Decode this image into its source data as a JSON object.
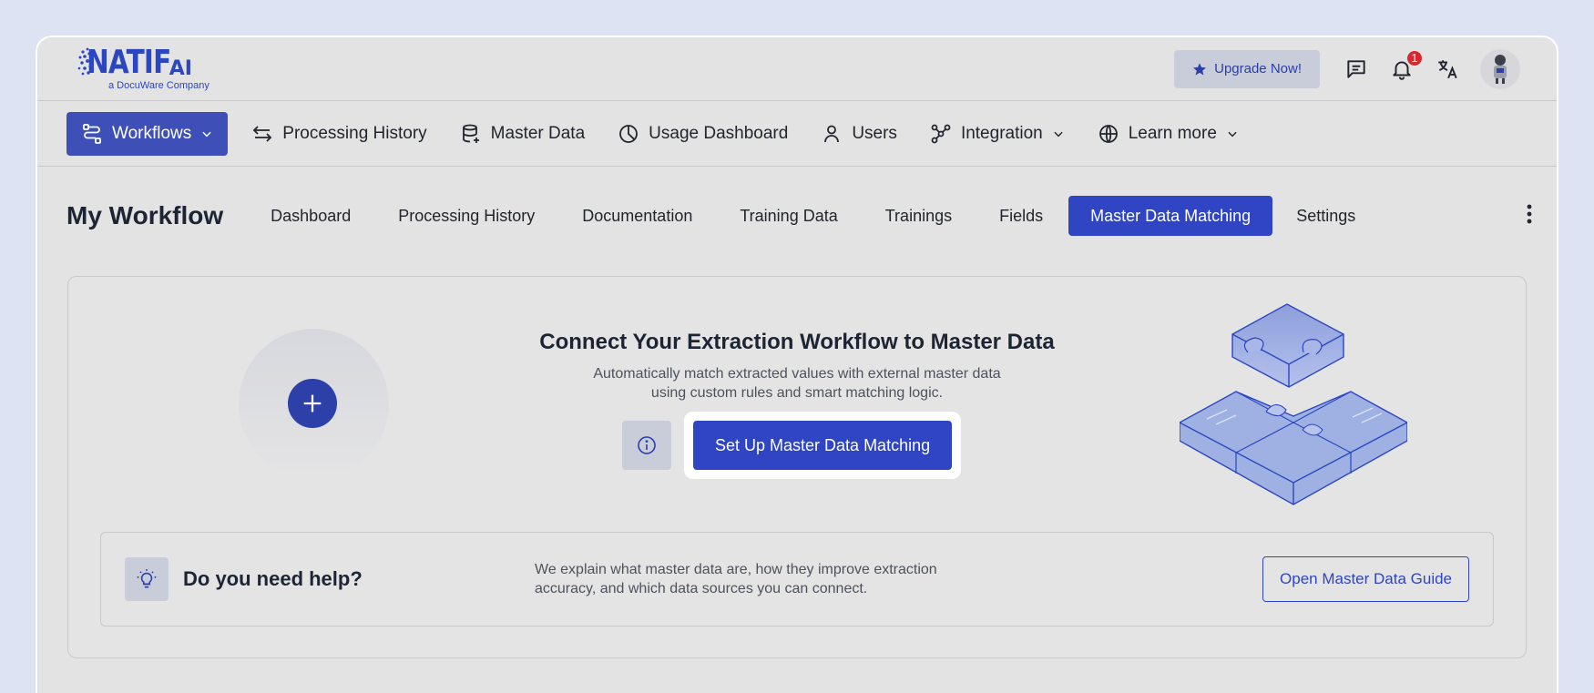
{
  "brand": {
    "logo_main": "NATIF",
    "logo_ai": "AI",
    "logo_sub": "a DocuWare Company"
  },
  "topbar": {
    "upgrade_label": "Upgrade Now!",
    "notification_count": "1"
  },
  "mainnav": {
    "items": [
      {
        "label": "Workflows",
        "icon": "workflow-icon",
        "active": true,
        "dropdown": true
      },
      {
        "label": "Processing History",
        "icon": "arrows-icon"
      },
      {
        "label": "Master Data",
        "icon": "database-icon"
      },
      {
        "label": "Usage Dashboard",
        "icon": "pie-chart-icon"
      },
      {
        "label": "Users",
        "icon": "user-icon"
      },
      {
        "label": "Integration",
        "icon": "integration-icon",
        "dropdown": true
      },
      {
        "label": "Learn more",
        "icon": "globe-icon",
        "dropdown": true
      }
    ]
  },
  "workflow": {
    "title": "My Workflow",
    "tabs": [
      {
        "label": "Dashboard"
      },
      {
        "label": "Processing History"
      },
      {
        "label": "Documentation"
      },
      {
        "label": "Training Data"
      },
      {
        "label": "Trainings"
      },
      {
        "label": "Fields"
      },
      {
        "label": "Master Data Matching",
        "active": true
      },
      {
        "label": "Settings"
      }
    ]
  },
  "hero": {
    "title": "Connect Your Extraction Workflow to Master Data",
    "subtitle_line1": "Automatically match extracted values with external master data",
    "subtitle_line2": "using custom rules and smart matching logic.",
    "setup_label": "Set Up Master Data Matching"
  },
  "help": {
    "title": "Do you need help?",
    "text_line1": "We explain what master data are, how they improve extraction",
    "text_line2": "accuracy, and which data sources you can connect.",
    "guide_label": "Open Master Data Guide"
  },
  "colors": {
    "accent": "#2f45c4",
    "nav_active": "#3e4fb8",
    "badge": "#d6282f"
  }
}
